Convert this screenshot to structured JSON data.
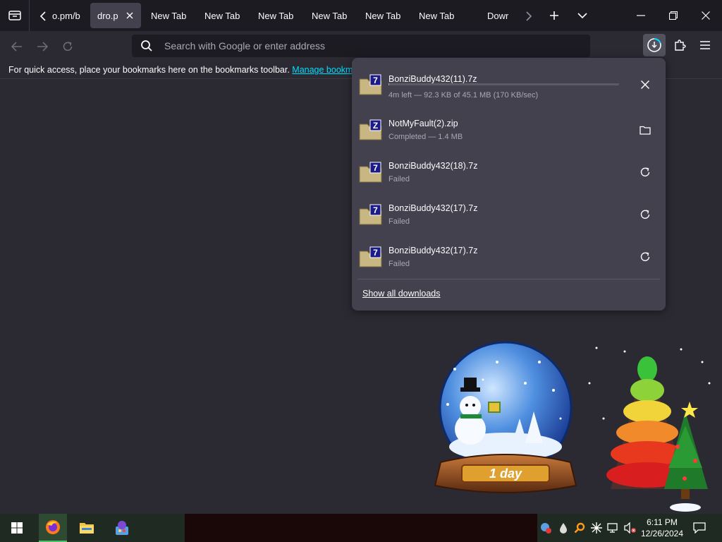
{
  "tabs": {
    "items": [
      {
        "label": "o.pm/b"
      },
      {
        "label": "dro.p"
      },
      {
        "label": "New Tab"
      },
      {
        "label": "New Tab"
      },
      {
        "label": "New Tab"
      },
      {
        "label": "New Tab"
      },
      {
        "label": "New Tab"
      },
      {
        "label": "New Tab"
      },
      {
        "label": "Dowr"
      }
    ]
  },
  "urlbar": {
    "placeholder": "Search with Google or enter address",
    "value": ""
  },
  "bookmarks": {
    "message": "For quick access, place your bookmarks here on the bookmarks toolbar. ",
    "link": "Manage bookmarks"
  },
  "downloads": {
    "items": [
      {
        "name": "BonziBuddy432(11).7z",
        "status": "4m left — 92.3 KB of 45.1 MB (170 KB/sec)",
        "progress": 0.002,
        "action": "cancel-icon"
      },
      {
        "name": "NotMyFault(2).zip",
        "status": "Completed — 1.4 MB",
        "action": "folder-icon"
      },
      {
        "name": "BonziBuddy432(18).7z",
        "status": "Failed",
        "action": "retry-icon"
      },
      {
        "name": "BonziBuddy432(17).7z",
        "status": "Failed",
        "action": "retry-icon"
      },
      {
        "name": "BonziBuddy432(17).7z",
        "status": "Failed",
        "action": "retry-icon"
      }
    ],
    "show_all": "Show all downloads"
  },
  "desktop": {
    "globe_label": "1 day"
  },
  "taskbar": {
    "time": "6:11 PM",
    "date": "12/26/2024"
  },
  "colors": {
    "accent_link": "#00ddff",
    "panel_bg": "#42414d",
    "page_bg": "#2b2a33",
    "tabstrip_bg": "#1c1b22"
  }
}
